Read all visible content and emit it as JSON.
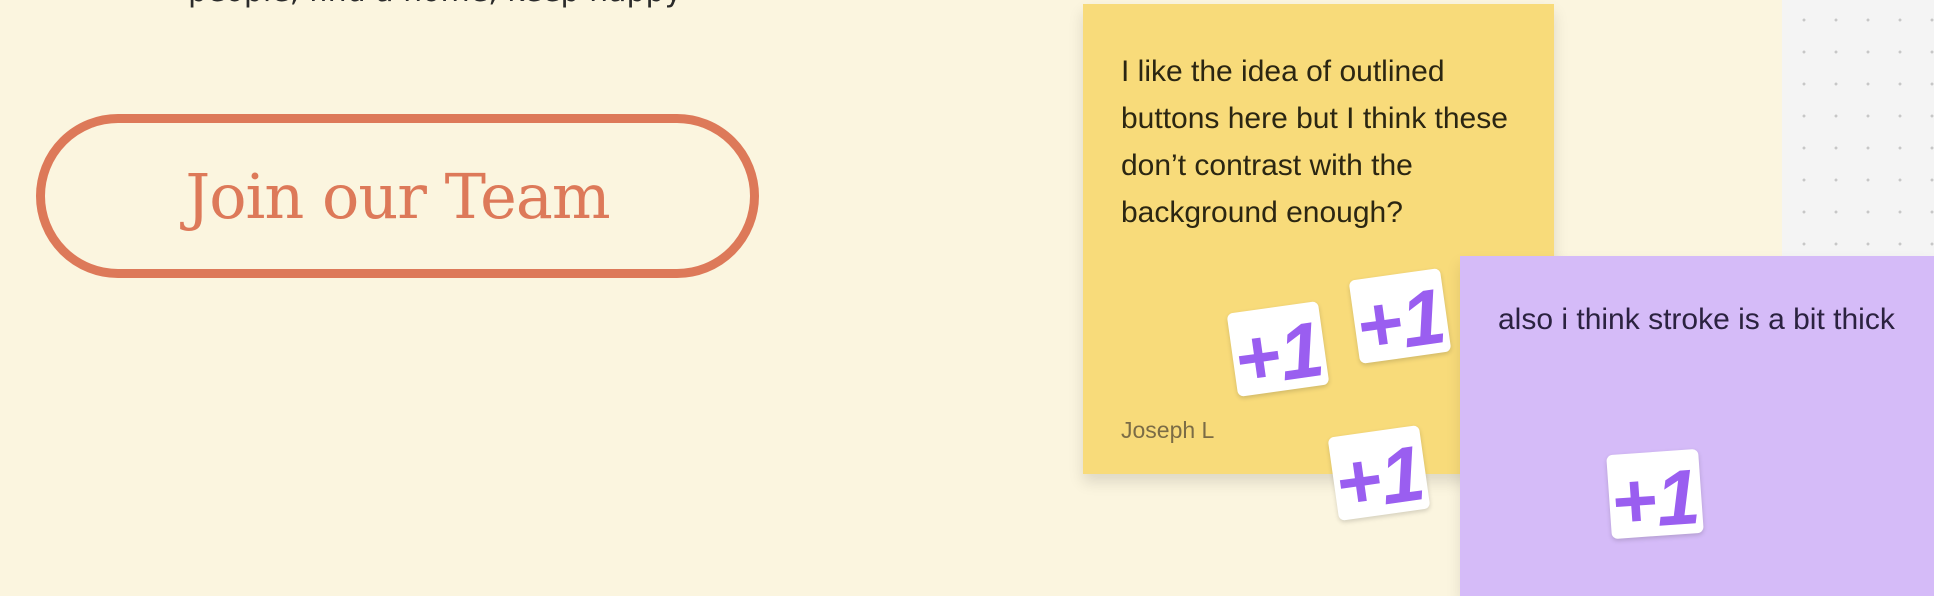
{
  "artboard": {
    "cut_off_text": "people, find a home, keep happy"
  },
  "cta_button": {
    "label": "Join our Team"
  },
  "comments": [
    {
      "text": "I like the idea of outlined buttons here but I think these don’t contrast with the background enough?",
      "author": "Joseph L",
      "color": "#f8db7a"
    },
    {
      "text": "also i think stroke is a bit thick",
      "color": "#d5bbf8"
    }
  ],
  "stickers": [
    {
      "label": "+1",
      "icon": "plus-one-sticker"
    },
    {
      "label": "+1",
      "icon": "plus-one-sticker"
    },
    {
      "label": "+1",
      "icon": "plus-one-sticker"
    },
    {
      "label": "+1",
      "icon": "plus-one-sticker"
    }
  ],
  "colors": {
    "artboard_bg": "#fbf5df",
    "button_outline": "#dd7959",
    "sticker_purple": "#9a5ef0"
  }
}
